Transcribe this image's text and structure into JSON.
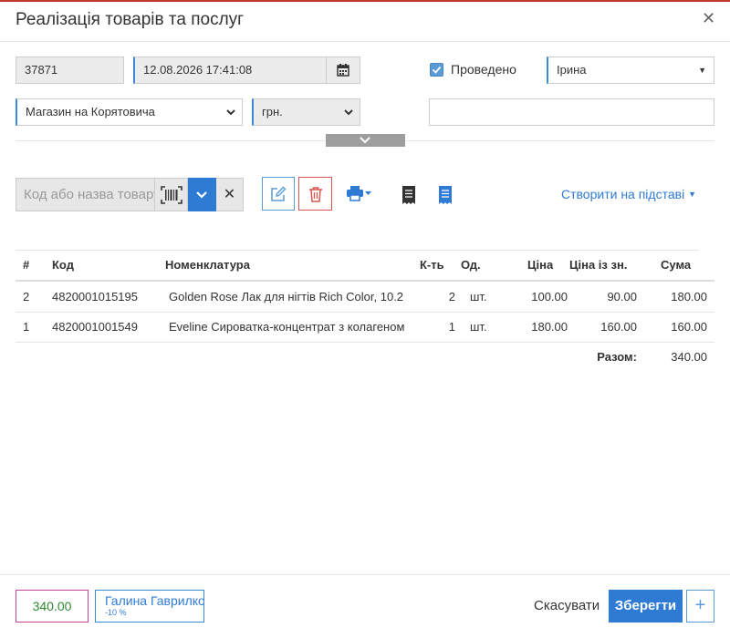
{
  "dialog": {
    "title": "Реалізація товарів та послуг"
  },
  "header_fields": {
    "doc_number": "37871",
    "datetime": "12.08.2026 17:41:08",
    "posted_label": "Проведено",
    "posted": true,
    "user": "Ірина",
    "store": "Магазин на Корятовича",
    "currency": "грн.",
    "comment": ""
  },
  "toolbar": {
    "search_placeholder": "Код або назва товару",
    "create_based_label": "Створити на підставі"
  },
  "table": {
    "columns": [
      "#",
      "Код",
      "Номенклатура",
      "К-ть",
      "Од.",
      "Ціна",
      "Ціна із зн.",
      "Сума"
    ],
    "rows": [
      {
        "n": "2",
        "code": "4820001015195",
        "name": "Golden Rose Лак для нігтів Rich Color, 10.2",
        "qty": "2",
        "unit": "шт.",
        "price": "100.00",
        "price_disc": "90.00",
        "sum": "180.00"
      },
      {
        "n": "1",
        "code": "4820001001549",
        "name": "Eveline Сироватка-концентрат з колагеном",
        "qty": "1",
        "unit": "шт.",
        "price": "180.00",
        "price_disc": "160.00",
        "sum": "160.00"
      }
    ],
    "total_label": "Разом:",
    "total_value": "340.00"
  },
  "footer": {
    "total": "340.00",
    "client_name": "Галина Гаврилко",
    "client_discount": "-10 %",
    "cancel_label": "Скасувати",
    "save_label": "Зберегти",
    "plus_label": "+"
  },
  "colors": {
    "accent": "#2f7bd4",
    "total_border": "#c9409b",
    "total_text": "#2e8b2e",
    "delete": "#d9534f"
  }
}
